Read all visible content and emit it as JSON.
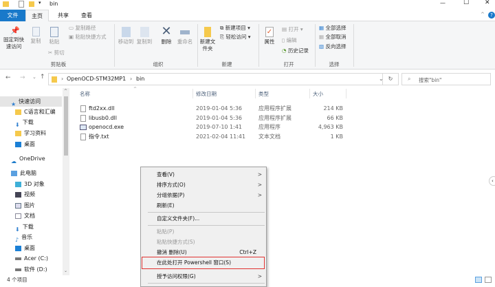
{
  "title": "bin",
  "window_controls": {
    "minimize": "—",
    "maximize": "☐",
    "close": "✕"
  },
  "tabs": [
    "文件",
    "主页",
    "共享",
    "查看"
  ],
  "ribbon": {
    "clipboard": {
      "pin": "固定到快速访问",
      "copy": "复制",
      "paste": "粘贴",
      "copy_path": "复制路径",
      "paste_shortcut": "粘贴快捷方式",
      "cut": "剪切",
      "label": "剪贴板"
    },
    "organize": {
      "move_to": "移动到",
      "copy_to": "复制到",
      "delete": "删除",
      "rename": "重命名",
      "label": "组织"
    },
    "new": {
      "new_folder": "新建文件夹",
      "new_item": "新建项目 ▾",
      "easy_access": "轻松访问 ▾",
      "label": "新建"
    },
    "open": {
      "properties": "属性",
      "open": "打开 ▾",
      "edit": "编辑",
      "history": "历史记录",
      "label": "打开"
    },
    "select": {
      "select_all": "全部选择",
      "select_none": "全部取消",
      "invert": "反向选择",
      "label": "选择"
    }
  },
  "address": {
    "crumbs": [
      "OpenOCD-STM32MP1",
      "bin"
    ],
    "search_placeholder": "搜索\"bin\""
  },
  "sidebar": [
    "快速访问",
    "C语言和汇编",
    "下载",
    "学习资料",
    "桌面",
    "OneDrive",
    "此电脑",
    "3D 对象",
    "视频",
    "图片",
    "文档",
    "下载",
    "音乐",
    "桌面",
    "Acer (C:)",
    "软件 (D:)"
  ],
  "columns": [
    "名称",
    "修改日期",
    "类型",
    "大小"
  ],
  "files": [
    {
      "name": "ftd2xx.dll",
      "date": "2019-01-04 5:36",
      "type": "应用程序扩展",
      "size": "214 KB"
    },
    {
      "name": "libusb0.dll",
      "date": "2019-01-04 5:36",
      "type": "应用程序扩展",
      "size": "66 KB"
    },
    {
      "name": "openocd.exe",
      "date": "2019-07-10 1:41",
      "type": "应用程序",
      "size": "4,963 KB"
    },
    {
      "name": "指令.txt",
      "date": "2021-02-04 11:41",
      "type": "文本文档",
      "size": "1 KB"
    }
  ],
  "context_menu": [
    {
      "label": "查看(V)",
      "sub": ">"
    },
    {
      "label": "排序方式(O)",
      "sub": ">"
    },
    {
      "label": "分组依据(P)",
      "sub": ">"
    },
    {
      "label": "刷新(E)"
    },
    {
      "label": "自定义文件夹(F)..."
    },
    {
      "label": "粘贴(P)"
    },
    {
      "label": "粘贴快捷方式(S)"
    },
    {
      "label": "撤消 删除(U)",
      "shortcut": "Ctrl+Z"
    },
    {
      "label": "在此处打开 Powershell 窗口(S)"
    },
    {
      "label": "授予访问权限(G)",
      "sub": ">"
    }
  ],
  "status": "4 个项目",
  "colors": {
    "accent": "#1979ca",
    "highlight_box": "#e0312f"
  }
}
